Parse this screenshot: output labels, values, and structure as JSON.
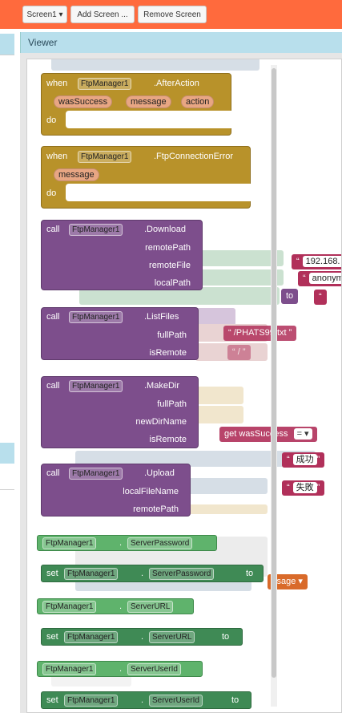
{
  "toolbar": {
    "screen_select": "Screen1 ▾",
    "add_screen": "Add Screen ...",
    "remove_screen": "Remove Screen"
  },
  "viewer": {
    "title": "Viewer"
  },
  "colors": {
    "topbar": "#ff6a3d",
    "event_block": "#b8922a",
    "method_block": "#7d4e8c",
    "setter_block": "#3f8a55",
    "getter_block": "#5fb36c",
    "text_block": "#b1305a"
  },
  "blocks": {
    "after_action": {
      "when": "when",
      "component": "FtpManager1",
      "event": ".AfterAction",
      "params": [
        "wasSuccess",
        "message",
        "action"
      ],
      "do": "do"
    },
    "ftp_error": {
      "when": "when",
      "component": "FtpManager1",
      "event": ".FtpConnectionError",
      "params": [
        "message"
      ],
      "do": "do"
    },
    "download": {
      "call": "call",
      "component": "FtpManager1",
      "method": ".Download",
      "args": [
        "remotePath",
        "remoteFile",
        "localPath"
      ]
    },
    "list_files": {
      "call": "call",
      "component": "FtpManager1",
      "method": ".ListFiles",
      "args": [
        "fullPath",
        "isRemote"
      ]
    },
    "make_dir": {
      "call": "call",
      "component": "FtpManager1",
      "method": ".MakeDir",
      "args": [
        "fullPath",
        "newDirName",
        "isRemote"
      ]
    },
    "upload": {
      "call": "call",
      "component": "FtpManager1",
      "method": ".Upload",
      "args": [
        "localFileName",
        "remotePath"
      ]
    },
    "get_password": {
      "component": "FtpManager1",
      "dot": ".",
      "prop": "ServerPassword"
    },
    "set_password": {
      "set": "set",
      "component": "FtpManager1",
      "dot": ".",
      "prop": "ServerPassword",
      "to": "to"
    },
    "get_url": {
      "component": "FtpManager1",
      "dot": ".",
      "prop": "ServerURL"
    },
    "set_url": {
      "set": "set",
      "component": "FtpManager1",
      "dot": ".",
      "prop": "ServerURL",
      "to": "to"
    },
    "get_userid": {
      "component": "FtpManager1",
      "dot": ".",
      "prop": "ServerUserId"
    },
    "set_userid": {
      "set": "set",
      "component": "FtpManager1",
      "dot": ".",
      "prop": "ServerUserId",
      "to": "to"
    }
  },
  "background_texts": {
    "ip": "192.168.",
    "anon": "anonym",
    "to": "to",
    "ats": "ATS99.txt",
    "path_prefix": "/PH",
    "slash": "/",
    "success": "成功",
    "fail": "失敗",
    "msg": "ssage ▾",
    "was_success": "wasSuccess",
    "get": "get",
    "eq": "= ▾",
    "quote": "“",
    "endquote": "”"
  }
}
